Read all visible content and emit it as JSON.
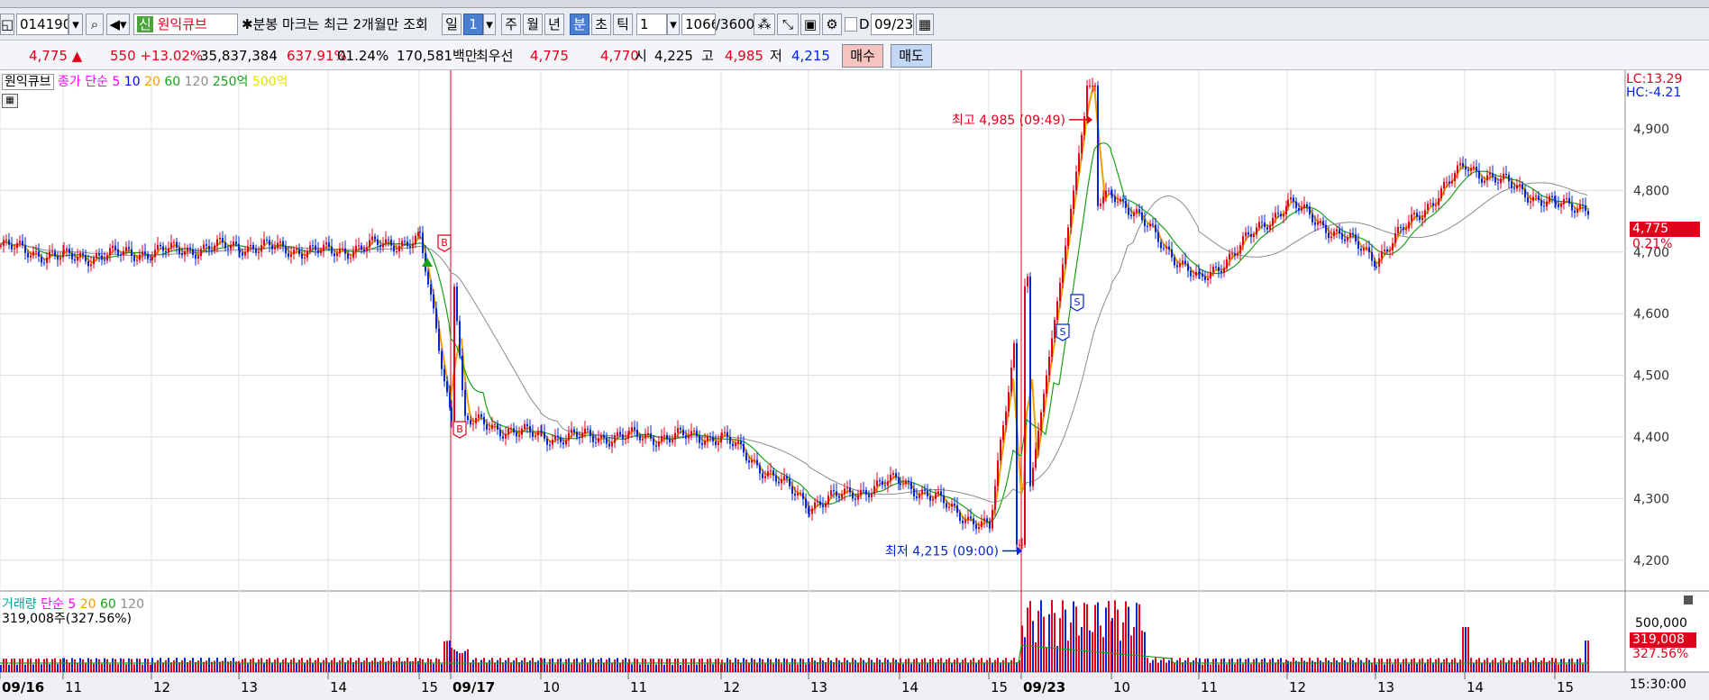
{
  "toolbar": {
    "code": "014190",
    "credit_badge": "신",
    "stock_name": "원익큐브",
    "notice": "분봉 마크는 최근 2개월만 조회",
    "periods": [
      "일",
      "1",
      "주",
      "월",
      "년",
      "분",
      "초",
      "틱"
    ],
    "selected_period": "분",
    "interval_value": "1",
    "count_value": "1066",
    "count_max": "/3600",
    "date_checkbox_label": "D",
    "date_value": "09/23"
  },
  "quote": {
    "price": "4,775",
    "change_arrow": "▲",
    "change": "550",
    "change_pct": "+13.02%",
    "volume": "35,837,384",
    "volume_ratio": "637.91%",
    "turnover": "01.24%",
    "amount": "170,581백만",
    "priority_label": "최우선",
    "ask": "4,775",
    "bid": "4,770",
    "open_label": "시",
    "open": "4,225",
    "high_label": "고",
    "high": "4,985",
    "low_label": "저",
    "low": "4,215",
    "buy_label": "매수",
    "sell_label": "매도"
  },
  "price_panel": {
    "legend_name": "원익큐브",
    "legend_ma_label": "종가 단순",
    "ma_periods": [
      "5",
      "10",
      "20",
      "60",
      "120"
    ],
    "extra_labels": [
      "250억",
      "500억"
    ],
    "lc": "LC:13.29",
    "hc": "HC:-4.21",
    "current_price": "4,775",
    "current_pct": "0.21%",
    "high_annotation": "최고 4,985 (09:49)",
    "low_annotation": "최저 4,215 (09:00)",
    "signal_b": "B",
    "signal_s": "S"
  },
  "volume_panel": {
    "legend_name": "거래량",
    "legend_ma_label": "단순",
    "ma_periods": [
      "5",
      "20",
      "60",
      "120"
    ],
    "current_volume": "319,008주(327.56%)",
    "axis_label": "500,000",
    "box_value": "319,008",
    "box_pct": "327.56%"
  },
  "time_axis": {
    "labels": [
      "09/16",
      "11",
      "12",
      "13",
      "14",
      "15",
      "09/17",
      "10",
      "11",
      "12",
      "13",
      "14",
      "15",
      "09/23",
      "10",
      "11",
      "12",
      "13",
      "14",
      "15"
    ],
    "end_time": "15:30:00"
  },
  "colors": {
    "up": "#e0001b",
    "down": "#0026d6",
    "ma5": "#ff00ff",
    "ma10": "#0000ff",
    "ma20": "#f0a000",
    "ma60": "#19a019",
    "ma120": "#8c8c8c"
  },
  "chart_data": {
    "type": "candlestick",
    "interval": "1 minute",
    "x": [
      "09/16",
      "09/16 11",
      "09/16 12",
      "09/16 13",
      "09/16 14",
      "09/16 15",
      "09/17",
      "09/17 10",
      "09/17 11",
      "09/17 12",
      "09/17 13",
      "09/17 14",
      "09/17 15",
      "09/23",
      "09/23 10",
      "09/23 11",
      "09/23 12",
      "09/23 13",
      "09/23 14",
      "09/23 15"
    ],
    "close": [
      4710,
      4690,
      4700,
      4710,
      4700,
      4720,
      4430,
      4400,
      4400,
      4400,
      4290,
      4330,
      4250,
      4650,
      4800,
      4650,
      4780,
      4690,
      4840,
      4775
    ],
    "ylim": [
      4150,
      4995
    ],
    "yticks": [
      4200,
      4300,
      4400,
      4500,
      4600,
      4700,
      4800,
      4900
    ],
    "high_point": {
      "label": "최고",
      "value": 4985,
      "time": "09:49"
    },
    "low_point": {
      "label": "최저",
      "value": 4215,
      "time": "09:00"
    }
  }
}
